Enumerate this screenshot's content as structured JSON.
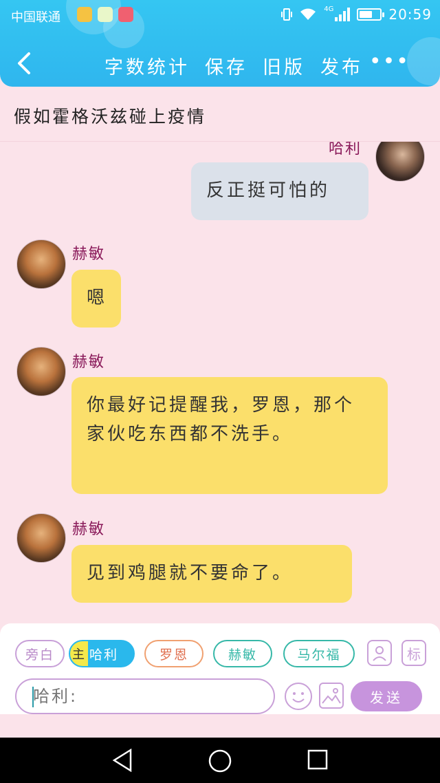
{
  "status_bar": {
    "carrier": "中国联通",
    "time": "20:59",
    "network": "4G",
    "battery_level": 0.65
  },
  "header": {
    "back_icon": "chevron-left-icon",
    "actions": [
      "字数统计",
      "保存",
      "旧版",
      "发布"
    ],
    "more": "•••"
  },
  "document": {
    "title": "假如霍格沃兹碰上疫情"
  },
  "messages": [
    {
      "sender": "哈利",
      "side": "right",
      "text": "反正挺可怕的",
      "style": "gray"
    },
    {
      "sender": "赫敏",
      "side": "left",
      "text": "嗯",
      "style": "yellow"
    },
    {
      "sender": "赫敏",
      "side": "left",
      "text": "你最好记提醒我，罗恩，那个家伙吃东西都不洗手。",
      "style": "yellow"
    },
    {
      "sender": "赫敏",
      "side": "left",
      "text": "见到鸡腿就不要命了。",
      "style": "yellow"
    }
  ],
  "roles": {
    "narration": "旁白",
    "main_mark": "主",
    "active": "哈利",
    "others": [
      "罗恩",
      "赫敏",
      "马尔福"
    ],
    "mark_button": "标"
  },
  "composer": {
    "placeholder": "哈利:",
    "send_label": "发送"
  },
  "colors": {
    "header": "#2fb6ee",
    "background": "#fbe3ea",
    "bubble_yellow": "#fbdf6b",
    "bubble_gray": "#dbe1ea",
    "send": "#c794dd"
  }
}
